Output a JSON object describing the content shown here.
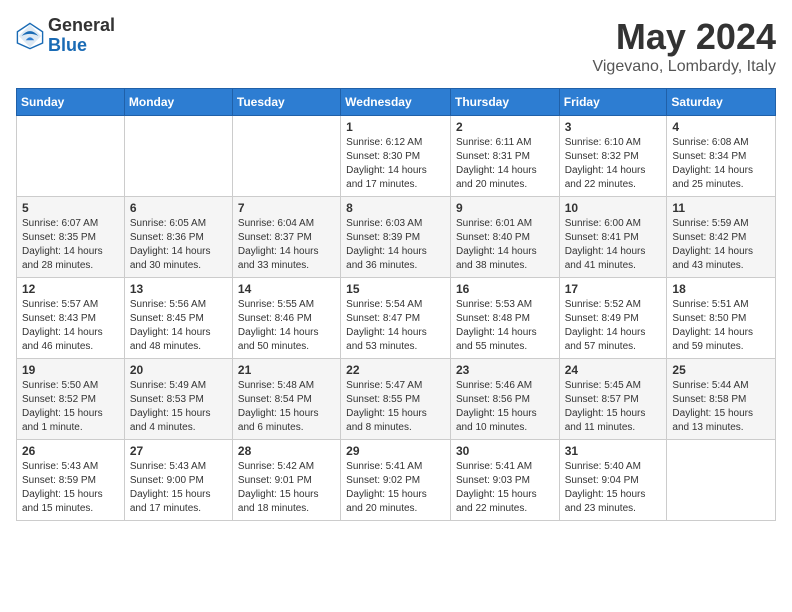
{
  "header": {
    "logo_general": "General",
    "logo_blue": "Blue",
    "month_title": "May 2024",
    "location": "Vigevano, Lombardy, Italy"
  },
  "days_of_week": [
    "Sunday",
    "Monday",
    "Tuesday",
    "Wednesday",
    "Thursday",
    "Friday",
    "Saturday"
  ],
  "weeks": [
    [
      {
        "day": "",
        "info": ""
      },
      {
        "day": "",
        "info": ""
      },
      {
        "day": "",
        "info": ""
      },
      {
        "day": "1",
        "info": "Sunrise: 6:12 AM\nSunset: 8:30 PM\nDaylight: 14 hours and 17 minutes."
      },
      {
        "day": "2",
        "info": "Sunrise: 6:11 AM\nSunset: 8:31 PM\nDaylight: 14 hours and 20 minutes."
      },
      {
        "day": "3",
        "info": "Sunrise: 6:10 AM\nSunset: 8:32 PM\nDaylight: 14 hours and 22 minutes."
      },
      {
        "day": "4",
        "info": "Sunrise: 6:08 AM\nSunset: 8:34 PM\nDaylight: 14 hours and 25 minutes."
      }
    ],
    [
      {
        "day": "5",
        "info": "Sunrise: 6:07 AM\nSunset: 8:35 PM\nDaylight: 14 hours and 28 minutes."
      },
      {
        "day": "6",
        "info": "Sunrise: 6:05 AM\nSunset: 8:36 PM\nDaylight: 14 hours and 30 minutes."
      },
      {
        "day": "7",
        "info": "Sunrise: 6:04 AM\nSunset: 8:37 PM\nDaylight: 14 hours and 33 minutes."
      },
      {
        "day": "8",
        "info": "Sunrise: 6:03 AM\nSunset: 8:39 PM\nDaylight: 14 hours and 36 minutes."
      },
      {
        "day": "9",
        "info": "Sunrise: 6:01 AM\nSunset: 8:40 PM\nDaylight: 14 hours and 38 minutes."
      },
      {
        "day": "10",
        "info": "Sunrise: 6:00 AM\nSunset: 8:41 PM\nDaylight: 14 hours and 41 minutes."
      },
      {
        "day": "11",
        "info": "Sunrise: 5:59 AM\nSunset: 8:42 PM\nDaylight: 14 hours and 43 minutes."
      }
    ],
    [
      {
        "day": "12",
        "info": "Sunrise: 5:57 AM\nSunset: 8:43 PM\nDaylight: 14 hours and 46 minutes."
      },
      {
        "day": "13",
        "info": "Sunrise: 5:56 AM\nSunset: 8:45 PM\nDaylight: 14 hours and 48 minutes."
      },
      {
        "day": "14",
        "info": "Sunrise: 5:55 AM\nSunset: 8:46 PM\nDaylight: 14 hours and 50 minutes."
      },
      {
        "day": "15",
        "info": "Sunrise: 5:54 AM\nSunset: 8:47 PM\nDaylight: 14 hours and 53 minutes."
      },
      {
        "day": "16",
        "info": "Sunrise: 5:53 AM\nSunset: 8:48 PM\nDaylight: 14 hours and 55 minutes."
      },
      {
        "day": "17",
        "info": "Sunrise: 5:52 AM\nSunset: 8:49 PM\nDaylight: 14 hours and 57 minutes."
      },
      {
        "day": "18",
        "info": "Sunrise: 5:51 AM\nSunset: 8:50 PM\nDaylight: 14 hours and 59 minutes."
      }
    ],
    [
      {
        "day": "19",
        "info": "Sunrise: 5:50 AM\nSunset: 8:52 PM\nDaylight: 15 hours and 1 minute."
      },
      {
        "day": "20",
        "info": "Sunrise: 5:49 AM\nSunset: 8:53 PM\nDaylight: 15 hours and 4 minutes."
      },
      {
        "day": "21",
        "info": "Sunrise: 5:48 AM\nSunset: 8:54 PM\nDaylight: 15 hours and 6 minutes."
      },
      {
        "day": "22",
        "info": "Sunrise: 5:47 AM\nSunset: 8:55 PM\nDaylight: 15 hours and 8 minutes."
      },
      {
        "day": "23",
        "info": "Sunrise: 5:46 AM\nSunset: 8:56 PM\nDaylight: 15 hours and 10 minutes."
      },
      {
        "day": "24",
        "info": "Sunrise: 5:45 AM\nSunset: 8:57 PM\nDaylight: 15 hours and 11 minutes."
      },
      {
        "day": "25",
        "info": "Sunrise: 5:44 AM\nSunset: 8:58 PM\nDaylight: 15 hours and 13 minutes."
      }
    ],
    [
      {
        "day": "26",
        "info": "Sunrise: 5:43 AM\nSunset: 8:59 PM\nDaylight: 15 hours and 15 minutes."
      },
      {
        "day": "27",
        "info": "Sunrise: 5:43 AM\nSunset: 9:00 PM\nDaylight: 15 hours and 17 minutes."
      },
      {
        "day": "28",
        "info": "Sunrise: 5:42 AM\nSunset: 9:01 PM\nDaylight: 15 hours and 18 minutes."
      },
      {
        "day": "29",
        "info": "Sunrise: 5:41 AM\nSunset: 9:02 PM\nDaylight: 15 hours and 20 minutes."
      },
      {
        "day": "30",
        "info": "Sunrise: 5:41 AM\nSunset: 9:03 PM\nDaylight: 15 hours and 22 minutes."
      },
      {
        "day": "31",
        "info": "Sunrise: 5:40 AM\nSunset: 9:04 PM\nDaylight: 15 hours and 23 minutes."
      },
      {
        "day": "",
        "info": ""
      }
    ]
  ]
}
